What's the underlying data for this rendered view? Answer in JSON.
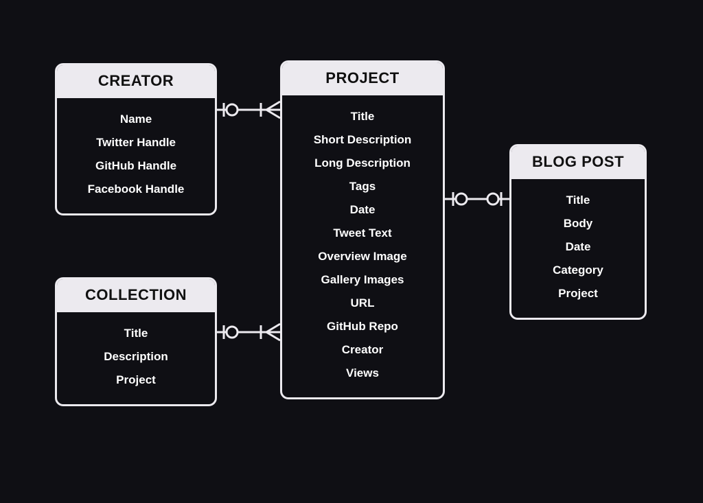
{
  "entities": {
    "creator": {
      "title": "CREATOR",
      "fields": [
        "Name",
        "Twitter Handle",
        "GitHub Handle",
        "Facebook Handle"
      ]
    },
    "project": {
      "title": "PROJECT",
      "fields": [
        "Title",
        "Short Description",
        "Long Description",
        "Tags",
        "Date",
        "Tweet Text",
        "Overview Image",
        "Gallery Images",
        "URL",
        "GitHub Repo",
        "Creator",
        "Views"
      ]
    },
    "blogpost": {
      "title": "BLOG POST",
      "fields": [
        "Title",
        "Body",
        "Date",
        "Category",
        "Project"
      ]
    },
    "collection": {
      "title": "COLLECTION",
      "fields": [
        "Title",
        "Description",
        "Project"
      ]
    }
  },
  "relationships": [
    {
      "from": "creator",
      "to": "project",
      "from_card": "zero-or-one",
      "to_card": "one-or-many"
    },
    {
      "from": "collection",
      "to": "project",
      "from_card": "zero-or-one",
      "to_card": "one-or-many"
    },
    {
      "from": "project",
      "to": "blogpost",
      "from_card": "zero-or-one",
      "to_card": "zero-or-one"
    }
  ],
  "colors": {
    "bg": "#0f0f14",
    "line": "#eceaef",
    "header_bg": "#eceaef",
    "text_light": "#ffffff",
    "text_dark": "#111111"
  }
}
